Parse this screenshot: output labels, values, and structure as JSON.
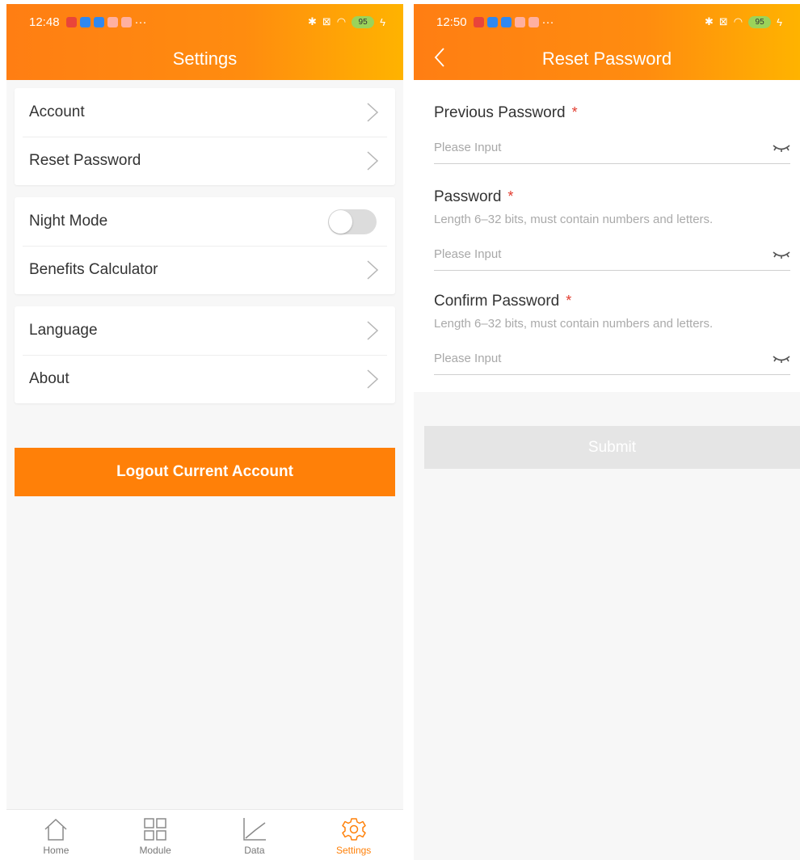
{
  "left_screen": {
    "status_bar": {
      "time": "12:48",
      "battery": "95"
    },
    "title": "Settings",
    "groups": [
      {
        "items": [
          {
            "label": "Account"
          },
          {
            "label": "Reset Password"
          }
        ]
      },
      {
        "items": [
          {
            "label": "Night Mode",
            "toggle": false
          },
          {
            "label": "Benefits Calculator"
          }
        ]
      },
      {
        "items": [
          {
            "label": "Language"
          },
          {
            "label": "About"
          }
        ]
      }
    ],
    "logout_label": "Logout Current Account",
    "tabs": [
      {
        "label": "Home",
        "icon": "home-icon",
        "active": false
      },
      {
        "label": "Module",
        "icon": "grid-icon",
        "active": false
      },
      {
        "label": "Data",
        "icon": "chart-icon",
        "active": false
      },
      {
        "label": "Settings",
        "icon": "gear-icon",
        "active": true
      }
    ]
  },
  "right_screen": {
    "status_bar": {
      "time": "12:50",
      "battery": "95"
    },
    "title": "Reset Password",
    "fields": [
      {
        "label": "Previous Password",
        "required_mark": "*",
        "hint": "",
        "placeholder": "Please Input"
      },
      {
        "label": "Password",
        "required_mark": "*",
        "hint": "Length 6–32 bits, must contain numbers and letters.",
        "placeholder": "Please Input"
      },
      {
        "label": "Confirm Password",
        "required_mark": "*",
        "hint": "Length 6–32 bits, must contain numbers and letters.",
        "placeholder": "Please Input"
      }
    ],
    "submit_label": "Submit"
  },
  "colors": {
    "accent": "#ff8008",
    "header_gradient_end": "#ffb300",
    "required": "#e23b2e"
  }
}
